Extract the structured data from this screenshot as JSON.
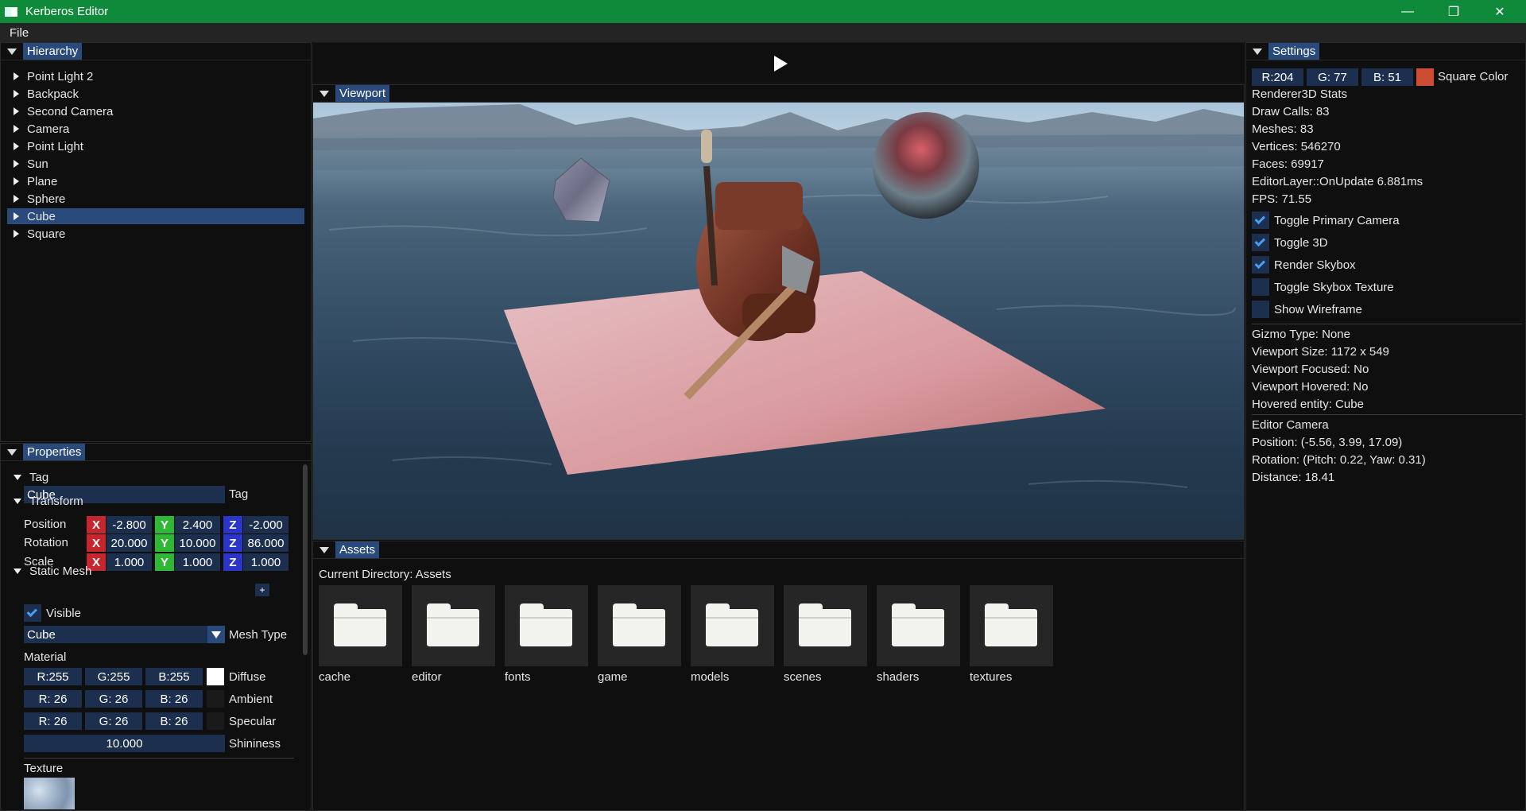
{
  "window": {
    "title": "Kerberos Editor"
  },
  "menu": {
    "file": "File"
  },
  "hierarchy": {
    "tab": "Hierarchy",
    "items": [
      {
        "label": "Point Light 2"
      },
      {
        "label": "Backpack"
      },
      {
        "label": "Second Camera"
      },
      {
        "label": "Camera"
      },
      {
        "label": "Point Light"
      },
      {
        "label": "Sun"
      },
      {
        "label": "Plane"
      },
      {
        "label": "Sphere"
      },
      {
        "label": "Cube",
        "selected": true
      },
      {
        "label": "Square"
      }
    ]
  },
  "properties": {
    "tab": "Properties",
    "tag_section": "Tag",
    "tag_value": "Cube",
    "tag_label": "Tag",
    "transform_section": "Transform",
    "position_label": "Position",
    "rotation_label": "Rotation",
    "scale_label": "Scale",
    "axis_x": "X",
    "axis_y": "Y",
    "axis_z": "Z",
    "position": [
      "-2.800",
      "2.400",
      "-2.000"
    ],
    "rotation": [
      "20.000",
      "10.000",
      "86.000"
    ],
    "scale": [
      "1.000",
      "1.000",
      "1.000"
    ],
    "static_mesh_section": "Static Mesh",
    "add_button": "+",
    "visible_label": "Visible",
    "visible": true,
    "mesh_type_value": "Cube",
    "mesh_type_label": "Mesh Type",
    "material_label": "Material",
    "diffuse": {
      "r": "R:255",
      "g": "G:255",
      "b": "B:255",
      "label": "Diffuse",
      "color": "#ffffff"
    },
    "ambient": {
      "r": "R: 26",
      "g": "G: 26",
      "b": "B: 26",
      "label": "Ambient",
      "color": "#1a1a1a"
    },
    "specular": {
      "r": "R: 26",
      "g": "G: 26",
      "b": "B: 26",
      "label": "Specular",
      "color": "#1a1a1a"
    },
    "shininess_value": "10.000",
    "shininess_label": "Shininess",
    "texture_label": "Texture"
  },
  "toolbar": {
    "play_icon": "play-icon"
  },
  "viewport": {
    "tab": "Viewport"
  },
  "assets": {
    "tab": "Assets",
    "current_directory": "Current Directory: Assets",
    "folders": [
      {
        "name": "cache"
      },
      {
        "name": "editor"
      },
      {
        "name": "fonts"
      },
      {
        "name": "game"
      },
      {
        "name": "models"
      },
      {
        "name": "scenes"
      },
      {
        "name": "shaders"
      },
      {
        "name": "textures"
      }
    ]
  },
  "settings": {
    "tab": "Settings",
    "square_color": {
      "r": "R:204",
      "g": "G: 77",
      "b": "B: 51",
      "label": "Square Color",
      "color": "#cc4d33"
    },
    "stats_title": "Renderer3D Stats",
    "draw_calls": "Draw Calls: 83",
    "meshes": "Meshes: 83",
    "vertices": "Vertices: 546270",
    "faces": "Faces: 69917",
    "on_update": "EditorLayer::OnUpdate 6.881ms",
    "fps": "FPS: 71.55",
    "toggles": [
      {
        "label": "Toggle Primary Camera",
        "checked": true
      },
      {
        "label": "Toggle 3D",
        "checked": true
      },
      {
        "label": "Render Skybox",
        "checked": true
      },
      {
        "label": "Toggle Skybox Texture",
        "checked": false
      },
      {
        "label": "Show Wireframe",
        "checked": false
      }
    ],
    "gizmo_type": "Gizmo Type: None",
    "viewport_size": "Viewport Size: 1172 x 549",
    "viewport_focused": "Viewport Focused: No",
    "viewport_hovered": "Viewport Hovered: No",
    "hovered_entity": "Hovered entity: Cube",
    "editor_camera": "Editor Camera",
    "camera_position": "Position: (-5.56, 3.99, 17.09)",
    "camera_rotation": "Rotation: (Pitch: 0.22, Yaw: 0.31)",
    "camera_distance": "Distance: 18.41"
  },
  "colors": {
    "titlebar": "#0f8a3a",
    "accent": "#294a7a",
    "frame": "#1d2f4f",
    "check": "#4a9cf0"
  }
}
